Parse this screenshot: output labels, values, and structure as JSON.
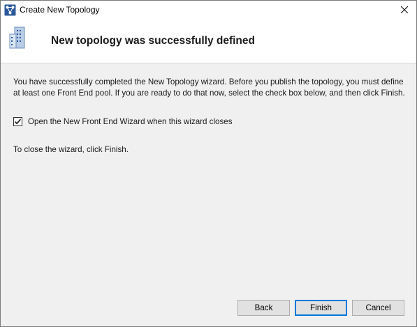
{
  "window": {
    "title": "Create New Topology",
    "icon": "topology-app-icon",
    "close_icon": "close-icon"
  },
  "header": {
    "title": "New topology was successfully defined",
    "icon": "building-icon"
  },
  "body": {
    "message": "You have successfully completed the New Topology wizard. Before you publish the topology, you must define at least one Front End pool. If you are ready to do that now, select the check box below, and then click Finish.",
    "checkbox": {
      "label": "Open the New Front End Wizard when this wizard closes",
      "checked": true
    },
    "close_instruction": "To close the wizard, click Finish."
  },
  "buttons": {
    "back": "Back",
    "finish": "Finish",
    "cancel": "Cancel"
  },
  "colors": {
    "accent": "#0078d7",
    "background": "#f0f0f0",
    "header_background": "#ffffff"
  }
}
